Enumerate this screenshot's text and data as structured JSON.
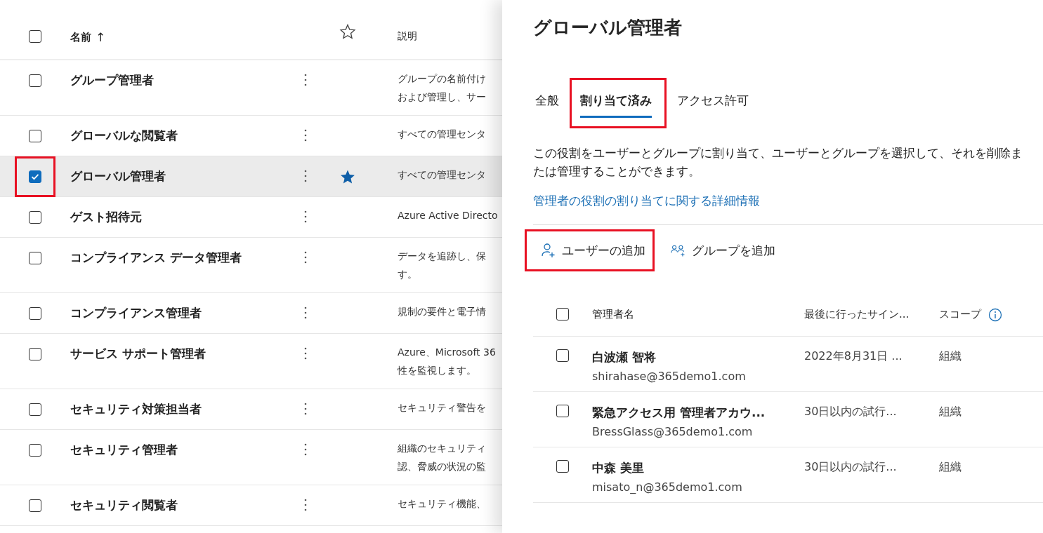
{
  "roles_table": {
    "select_all_checked": false,
    "columns": {
      "name": "名前",
      "sort_arrow": "↑",
      "description": "説明"
    },
    "rows": [
      {
        "name": "グループ管理者",
        "checked": false,
        "selected": false,
        "starred": false,
        "highlighted": false,
        "description": [
          "グループの名前付け",
          "および管理し、サー"
        ]
      },
      {
        "name": "グローバルな閲覧者",
        "checked": false,
        "selected": false,
        "starred": false,
        "highlighted": false,
        "description": [
          "すべての管理センタ"
        ]
      },
      {
        "name": "グローバル管理者",
        "checked": true,
        "selected": true,
        "starred": true,
        "highlighted": true,
        "description": [
          "すべての管理センタ"
        ]
      },
      {
        "name": "ゲスト招待元",
        "checked": false,
        "selected": false,
        "starred": false,
        "highlighted": false,
        "description": [
          "Azure Active Directo"
        ]
      },
      {
        "name": "コンプライアンス データ管理者",
        "checked": false,
        "selected": false,
        "starred": false,
        "highlighted": false,
        "description": [
          "データを追跡し、保",
          "す。"
        ]
      },
      {
        "name": "コンプライアンス管理者",
        "checked": false,
        "selected": false,
        "starred": false,
        "highlighted": false,
        "description": [
          "規制の要件と電子情"
        ]
      },
      {
        "name": "サービス サポート管理者",
        "checked": false,
        "selected": false,
        "starred": false,
        "highlighted": false,
        "description": [
          "Azure、Microsoft 36",
          "性を監視します。"
        ]
      },
      {
        "name": "セキュリティ対策担当者",
        "checked": false,
        "selected": false,
        "starred": false,
        "highlighted": false,
        "description": [
          "セキュリティ警告を"
        ]
      },
      {
        "name": "セキュリティ管理者",
        "checked": false,
        "selected": false,
        "starred": false,
        "highlighted": false,
        "description": [
          "組織のセキュリティ",
          "認、脅威の状況の監"
        ]
      },
      {
        "name": "セキュリティ閲覧者",
        "checked": false,
        "selected": false,
        "starred": false,
        "highlighted": false,
        "description": [
          "セキュリティ機能、"
        ]
      }
    ]
  },
  "panel": {
    "title": "グローバル管理者",
    "tabs": [
      {
        "label": "全般",
        "selected": false,
        "highlighted": false
      },
      {
        "label": "割り当て済み",
        "selected": true,
        "highlighted": true
      },
      {
        "label": "アクセス許可",
        "selected": false,
        "highlighted": false
      }
    ],
    "description": "この役割をユーザーとグループに割り当て、ユーザーとグループを選択して、それを削除または管理することができます。",
    "link": "管理者の役割の割り当てに関する詳細情報",
    "commands": [
      {
        "kind": "user",
        "label": "ユーザーの追加",
        "highlighted": true
      },
      {
        "kind": "group",
        "label": "グループを追加",
        "highlighted": false
      }
    ],
    "table": {
      "select_all_checked": false,
      "columns": [
        "管理者名",
        "最後に行ったサイン...",
        "スコープ"
      ],
      "rows": [
        {
          "name": "白波瀬 智将",
          "email": "shirahase@365demo1.com",
          "last_sign_in": "2022年8月31日 ...",
          "scope": "組織",
          "checked": false
        },
        {
          "name": "緊急アクセス用 管理者アカウ...",
          "email": "BressGlass@365demo1.com",
          "last_sign_in": "30日以内の試行...",
          "scope": "組織",
          "checked": false
        },
        {
          "name": "中森 美里",
          "email": "misato_n@365demo1.com",
          "last_sign_in": "30日以内の試行...",
          "scope": "組織",
          "checked": false
        }
      ]
    }
  }
}
